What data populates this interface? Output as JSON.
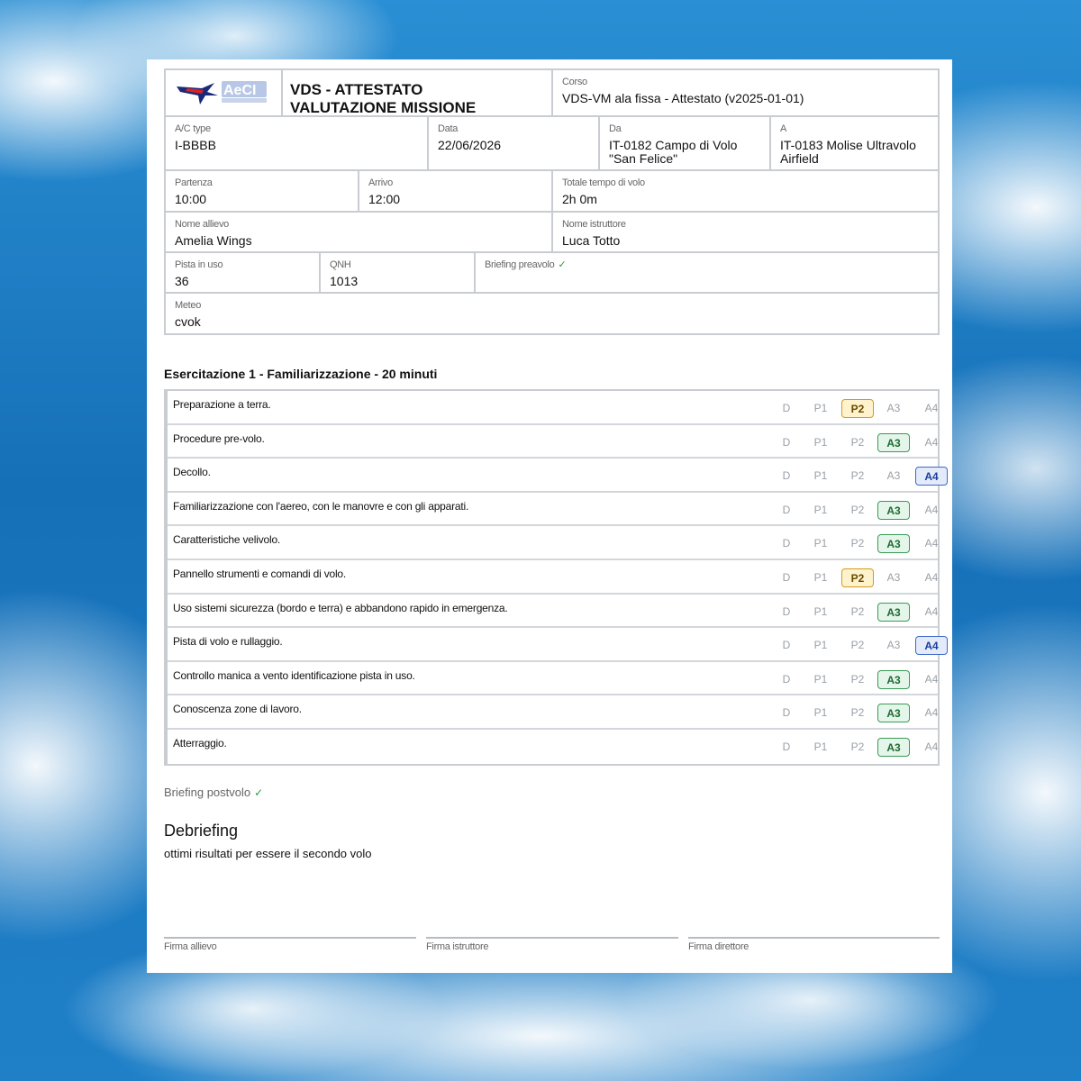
{
  "header": {
    "logo_text": "AeCI",
    "title_line1": "VDS - ATTESTATO",
    "title_line2": "VALUTAZIONE MISSIONE",
    "corso": {
      "label": "Corso",
      "value": "VDS-VM ala fissa - Attestato (v2025-01-01)"
    },
    "ac_type": {
      "label": "A/C type",
      "value": "I-BBBB"
    },
    "data": {
      "label": "Data",
      "value": "22/06/2026"
    },
    "da": {
      "label": "Da",
      "value_line1": "IT-0182 Campo di Volo",
      "value_line2": "\"San Felice\""
    },
    "a": {
      "label": "A",
      "value_line1": "IT-0183 Molise Ultravolo",
      "value_line2": "Airfield"
    },
    "partenza": {
      "label": "Partenza",
      "value": "10:00"
    },
    "arrivo": {
      "label": "Arrivo",
      "value": "12:00"
    },
    "totale": {
      "label": "Totale tempo di volo",
      "value": "2h 0m"
    },
    "allievo": {
      "label": "Nome allievo",
      "value": "Amelia Wings"
    },
    "istruttore": {
      "label": "Nome istruttore",
      "value": "Luca Totto"
    },
    "pista": {
      "label": "Pista in uso",
      "value": "36"
    },
    "qnh": {
      "label": "QNH",
      "value": "1013"
    },
    "briefing_pre": {
      "label": "Briefing preavolo",
      "check": "✓"
    },
    "meteo": {
      "label": "Meteo",
      "value": "cvok"
    }
  },
  "exercise": {
    "title": "Esercitazione 1 - Familiarizzazione - 20 minuti",
    "grade_labels": [
      "D",
      "P1",
      "P2",
      "A3",
      "A4"
    ],
    "items": [
      {
        "label": "Preparazione a terra.",
        "grade": "P2"
      },
      {
        "label": "Procedure pre-volo.",
        "grade": "A3"
      },
      {
        "label": "Decollo.",
        "grade": "A4"
      },
      {
        "label": "Familiarizzazione con l'aereo, con le manovre e con gli apparati.",
        "grade": "A3"
      },
      {
        "label": "Caratteristiche velivolo.",
        "grade": "A3"
      },
      {
        "label": "Pannello strumenti e comandi di volo.",
        "grade": "P2"
      },
      {
        "label": "Uso sistemi sicurezza (bordo e terra) e abbandono rapido in emergenza.",
        "grade": "A3"
      },
      {
        "label": "Pista di volo e rullaggio.",
        "grade": "A4"
      },
      {
        "label": "Controllo manica a vento identificazione pista in uso.",
        "grade": "A3"
      },
      {
        "label": "Conoscenza zone di lavoro.",
        "grade": "A3"
      },
      {
        "label": "Atterraggio.",
        "grade": "A3"
      }
    ]
  },
  "briefing_post": {
    "label": "Briefing postvolo",
    "check": "✓"
  },
  "debriefing": {
    "title": "Debriefing",
    "text": "ottimi risultati per essere il secondo volo"
  },
  "signatures": {
    "allievo": "Firma allievo",
    "istruttore": "Firma istruttore",
    "direttore": "Firma direttore"
  },
  "colors": {
    "sky": "#1b7fc4",
    "border": "#c9ccd1",
    "p2": "#d39b1e",
    "a3": "#3a9b57",
    "a4": "#3e68c8",
    "check": "#2e9a43"
  }
}
